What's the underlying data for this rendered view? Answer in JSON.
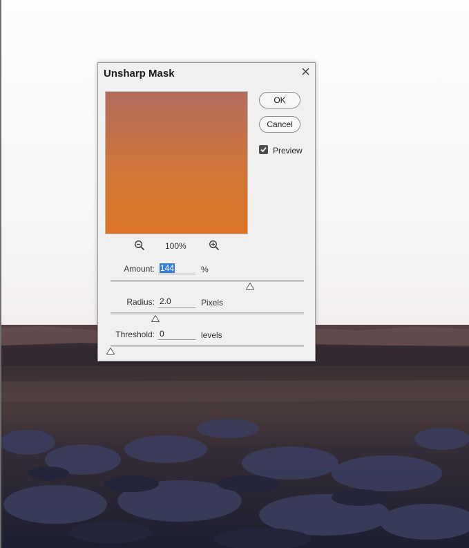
{
  "dialog": {
    "title": "Unsharp Mask",
    "ok_label": "OK",
    "cancel_label": "Cancel",
    "preview_label": "Preview",
    "preview_checked": true,
    "zoom_level": "100%",
    "amount": {
      "label": "Amount:",
      "value": "144",
      "unit": "%",
      "min": 1,
      "max": 500
    },
    "radius": {
      "label": "Radius:",
      "value": "2.0",
      "unit": "Pixels",
      "min": 0.1,
      "max": 250
    },
    "threshold": {
      "label": "Threshold:",
      "value": "0",
      "unit": "levels",
      "min": 0,
      "max": 255
    }
  },
  "icons": {
    "close": "close-icon",
    "zoom_out": "zoom-out-icon",
    "zoom_in": "zoom-in-icon",
    "checkbox": "checkmark-icon"
  },
  "colors": {
    "selection": "#3b7dd8",
    "preview_top": "#b46c5c",
    "preview_bottom": "#dc7424"
  }
}
